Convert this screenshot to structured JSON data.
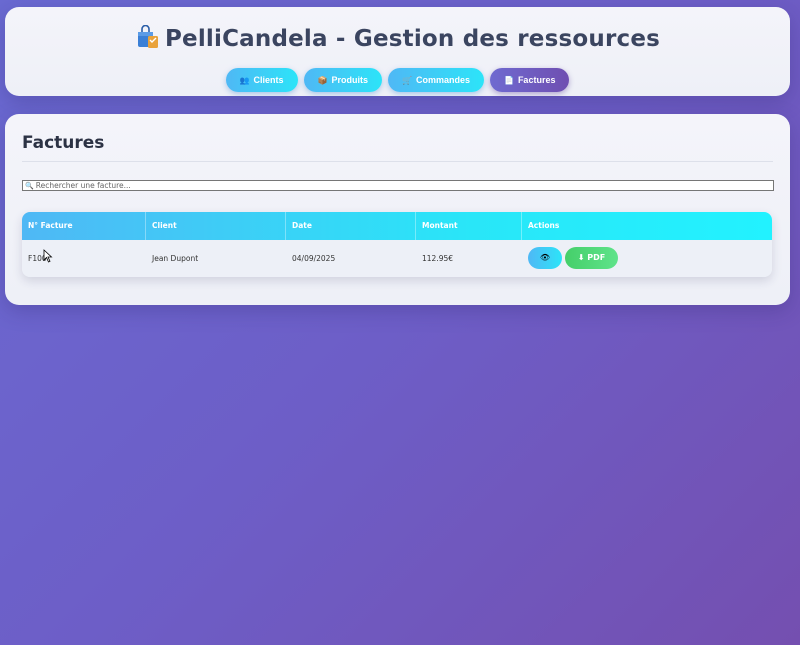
{
  "header": {
    "title": "PelliCandela - Gestion des ressources",
    "nav": [
      {
        "label": "Clients",
        "icon": "users-icon",
        "glyph": "👥",
        "active": false
      },
      {
        "label": "Produits",
        "icon": "box-icon",
        "glyph": "📦",
        "active": false
      },
      {
        "label": "Commandes",
        "icon": "cart-icon",
        "glyph": "🛒",
        "active": false
      },
      {
        "label": "Factures",
        "icon": "invoice-icon",
        "glyph": "📄",
        "active": true
      }
    ]
  },
  "main": {
    "section_title": "Factures",
    "search": {
      "placeholder": "Rechercher une facture..."
    },
    "table": {
      "columns": [
        "N° Facture",
        "Client",
        "Date",
        "Montant",
        "Actions"
      ],
      "rows": [
        {
          "numero": "F100",
          "client": "Jean Dupont",
          "date": "04/09/2025",
          "montant": "112.95€",
          "view_glyph": "👁",
          "pdf_label": "PDF",
          "pdf_glyph": "⬇"
        }
      ]
    }
  },
  "colors": {
    "accent_cyan": "#2ce4f8",
    "accent_blue": "#4fb8f5",
    "active_purple": "#6f6ad0",
    "pdf_green": "#45cf6a",
    "background": "#6d5ec7"
  }
}
